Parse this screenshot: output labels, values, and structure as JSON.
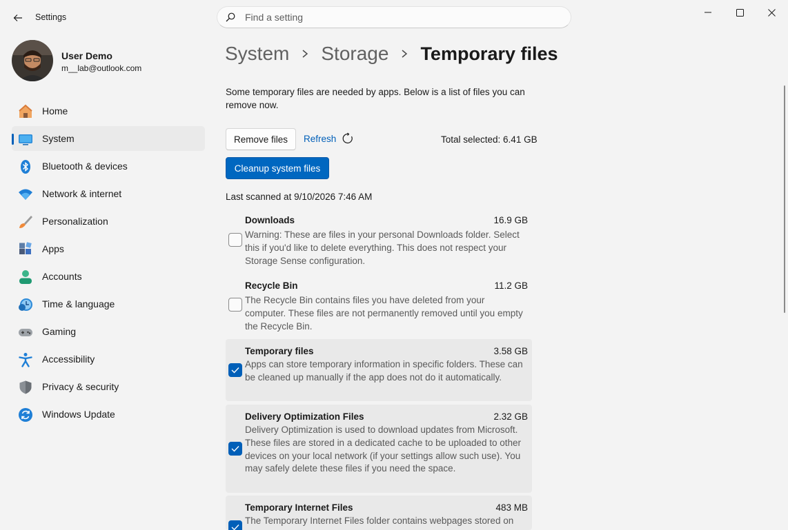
{
  "app": {
    "title": "Settings"
  },
  "search": {
    "placeholder": "Find a setting"
  },
  "user": {
    "name": "User Demo",
    "email": "m__lab@outlook.com"
  },
  "nav": {
    "items": [
      {
        "label": "Home",
        "icon": "home-icon"
      },
      {
        "label": "System",
        "icon": "system-icon",
        "selected": true
      },
      {
        "label": "Bluetooth & devices",
        "icon": "bluetooth-icon"
      },
      {
        "label": "Network & internet",
        "icon": "wifi-icon"
      },
      {
        "label": "Personalization",
        "icon": "brush-icon"
      },
      {
        "label": "Apps",
        "icon": "apps-icon"
      },
      {
        "label": "Accounts",
        "icon": "accounts-icon"
      },
      {
        "label": "Time & language",
        "icon": "clock-globe-icon"
      },
      {
        "label": "Gaming",
        "icon": "gamepad-icon"
      },
      {
        "label": "Accessibility",
        "icon": "accessibility-icon"
      },
      {
        "label": "Privacy & security",
        "icon": "shield-icon"
      },
      {
        "label": "Windows Update",
        "icon": "update-icon"
      }
    ]
  },
  "breadcrumb": {
    "items": [
      "System",
      "Storage",
      "Temporary files"
    ]
  },
  "main": {
    "description": "Some temporary files are needed by apps. Below is a list of files you can remove now.",
    "remove_label": "Remove files",
    "refresh_label": "Refresh",
    "total_selected": "Total selected: 6.41 GB",
    "cleanup_label": "Cleanup system files",
    "last_scanned": "Last scanned at 9/10/2026 7:46 AM"
  },
  "files": [
    {
      "name": "Downloads",
      "size": "16.9 GB",
      "checked": false,
      "description": "Warning: These are files in your personal Downloads folder. Select this if you'd like to delete everything. This does not respect your Storage Sense configuration."
    },
    {
      "name": "Recycle Bin",
      "size": "11.2 GB",
      "checked": false,
      "description": "The Recycle Bin contains files you have deleted from your computer. These files are not permanently removed until you empty the Recycle Bin."
    },
    {
      "name": "Temporary files",
      "size": "3.58 GB",
      "checked": true,
      "description": "Apps can store temporary information in specific folders. These can be cleaned up manually if the app does not do it automatically."
    },
    {
      "name": "Delivery Optimization Files",
      "size": "2.32 GB",
      "checked": true,
      "description": "Delivery Optimization is used to download updates from Microsoft. These files are stored in a dedicated cache to be uploaded to other devices on your local network (if your settings allow such use). You may safely delete these files if you need the space."
    },
    {
      "name": "Temporary Internet Files",
      "size": "483 MB",
      "checked": true,
      "description": "The Temporary Internet Files folder contains webpages stored on"
    }
  ],
  "colors": {
    "accent": "#005fb8",
    "accent_button": "#0067c0",
    "background": "#f3f3f3"
  }
}
